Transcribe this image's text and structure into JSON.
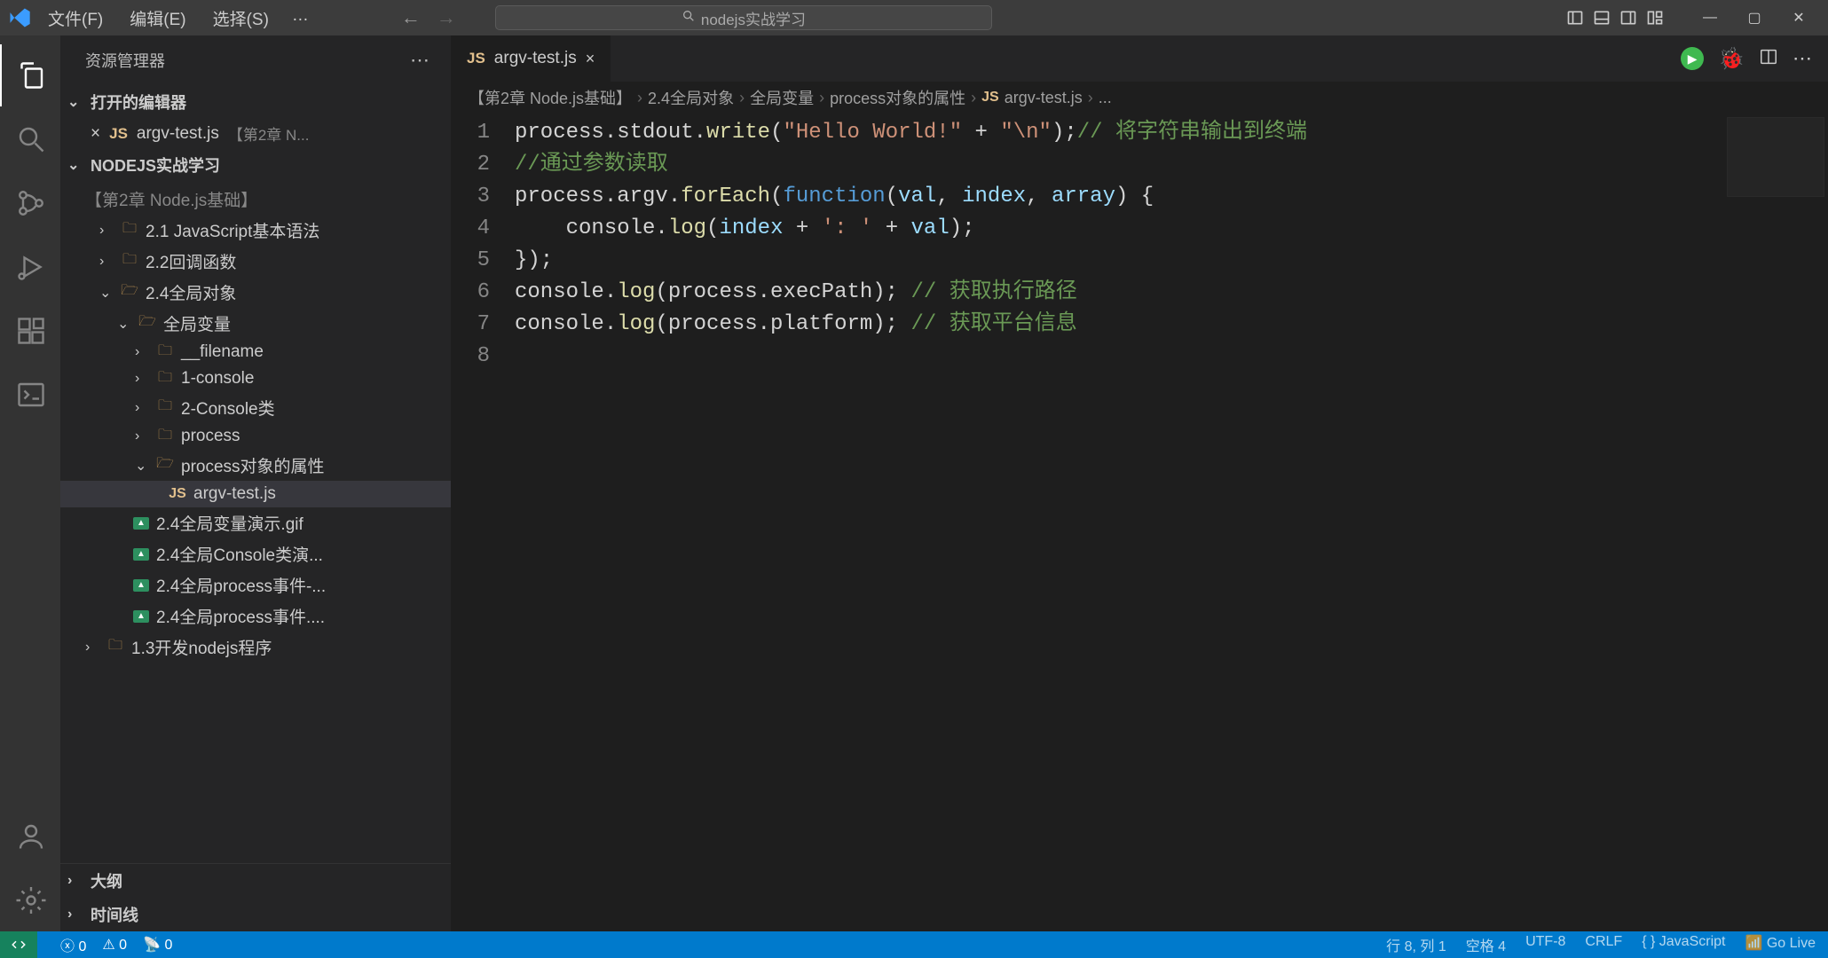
{
  "menu": {
    "file": "文件(F)",
    "edit": "编辑(E)",
    "select": "选择(S)",
    "more": "…"
  },
  "search_placeholder": "nodejs实战学习",
  "sidebar": {
    "title": "资源管理器",
    "open_editors": "打开的编辑器",
    "open_file": "argv-test.js",
    "open_file_path": "【第2章 N...",
    "project": "NODEJS实战学习",
    "tree": {
      "chapter2": "【第2章 Node.js基础】",
      "f21": "2.1 JavaScript基本语法",
      "f22": "2.2回调函数",
      "f24": "2.4全局对象",
      "global_var": "全局变量",
      "filename": "__filename",
      "console1": "1-console",
      "console2": "2-Console类",
      "process": "process",
      "process_attr": "process对象的属性",
      "argv": "argv-test.js",
      "gif1": "2.4全局变量演示.gif",
      "gif2": "2.4全局Console类演...",
      "gif3": "2.4全局process事件-...",
      "gif4": "2.4全局process事件....",
      "f13": "1.3开发nodejs程序"
    },
    "outline": "大纲",
    "timeline": "时间线"
  },
  "tab": {
    "name": "argv-test.js"
  },
  "breadcrumbs": {
    "b1": "【第2章 Node.js基础】",
    "b2": "2.4全局对象",
    "b3": "全局变量",
    "b4": "process对象的属性",
    "b5": "argv-test.js",
    "b6": "..."
  },
  "code": {
    "l1a": "process.stdout.",
    "l1write": "write",
    "l1p1": "(",
    "l1s1": "\"Hello World!\"",
    "l1plus": " + ",
    "l1s2": "\"\\n\"",
    "l1p2": ");",
    "l1c": "// 将字符串输出到终端",
    "l2": "//通过参数读取",
    "l3a": "process.argv.",
    "l3fe": "forEach",
    "l3p1": "(",
    "l3fn": "function",
    "l3p2": "(",
    "l3v": "val",
    "l3c1": ", ",
    "l3i": "index",
    "l3c2": ", ",
    "l3arr": "array",
    "l3p3": ") {",
    "l4a": "    console.",
    "l4log": "log",
    "l4p1": "(",
    "l4idx": "index",
    "l4plus": " + ",
    "l4s": "': '",
    "l4plus2": " + ",
    "l4val": "val",
    "l4p2": ");",
    "l5": "});",
    "l6a": "console.",
    "l6log": "log",
    "l6p1": "(process.execPath); ",
    "l6c": "// 获取执行路径",
    "l7a": "console.",
    "l7log": "log",
    "l7p1": "(process.platform); ",
    "l7c": "// 获取平台信息"
  },
  "status": {
    "errors": "0",
    "warnings": "0",
    "port": "0",
    "line": "行 8",
    "col": "列 1",
    "spaces": "空格 4",
    "enc": "UTF-8",
    "eol": "CRLF",
    "lang": "{ } JavaScript",
    "golive": "Go Live"
  }
}
